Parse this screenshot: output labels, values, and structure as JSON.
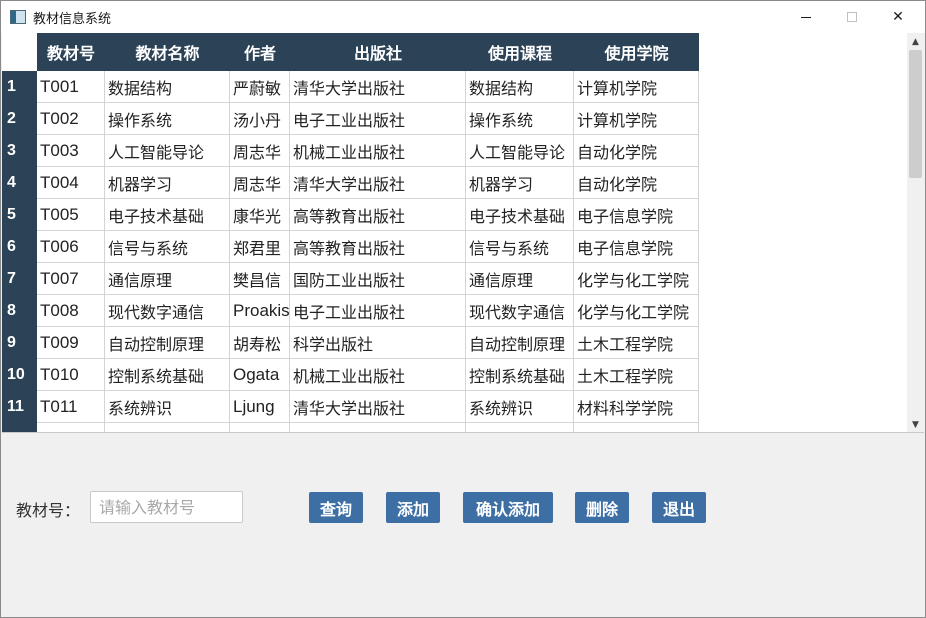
{
  "window": {
    "title": "教材信息系统",
    "minimize_icon": "minimize-icon",
    "maximize_icon": "maximize-icon",
    "close_icon": "close-icon",
    "close_glyph": "✕"
  },
  "table": {
    "columns": [
      "教材号",
      "教材名称",
      "作者",
      "出版社",
      "使用课程",
      "使用学院"
    ],
    "row_numbers": [
      "1",
      "2",
      "3",
      "4",
      "5",
      "6",
      "7",
      "8",
      "9",
      "10",
      "11"
    ],
    "rows": [
      [
        "T001",
        "数据结构",
        "严蔚敏",
        "清华大学出版社",
        "数据结构",
        "计算机学院"
      ],
      [
        "T002",
        "操作系统",
        "汤小丹",
        "电子工业出版社",
        "操作系统",
        "计算机学院"
      ],
      [
        "T003",
        "人工智能导论",
        "周志华",
        "机械工业出版社",
        "人工智能导论",
        "自动化学院"
      ],
      [
        "T004",
        "机器学习",
        "周志华",
        "清华大学出版社",
        "机器学习",
        "自动化学院"
      ],
      [
        "T005",
        "电子技术基础",
        "康华光",
        "高等教育出版社",
        "电子技术基础",
        "电子信息学院"
      ],
      [
        "T006",
        "信号与系统",
        "郑君里",
        "高等教育出版社",
        "信号与系统",
        "电子信息学院"
      ],
      [
        "T007",
        "通信原理",
        "樊昌信",
        "国防工业出版社",
        "通信原理",
        "化学与化工学院"
      ],
      [
        "T008",
        "现代数字通信",
        "Proakis",
        "电子工业出版社",
        "现代数字通信",
        "化学与化工学院"
      ],
      [
        "T009",
        "自动控制原理",
        "胡寿松",
        "科学出版社",
        "自动控制原理",
        "土木工程学院"
      ],
      [
        "T010",
        "控制系统基础",
        "Ogata",
        "机械工业出版社",
        "控制系统基础",
        "土木工程学院"
      ],
      [
        "T011",
        "系统辨识",
        "Ljung",
        "清华大学出版社",
        "系统辨识",
        "材料科学学院"
      ]
    ],
    "header_color": "#2b4257"
  },
  "scrollbar": {
    "up_glyph": "▲",
    "down_glyph": "▼"
  },
  "controls": {
    "field_label": "教材号：",
    "input_placeholder": "请输入教材号",
    "input_value": "",
    "buttons": {
      "query": "查询",
      "add": "添加",
      "confirm_add": "确认添加",
      "delete": "删除",
      "exit": "退出"
    },
    "button_color": "#3d6fa5"
  }
}
